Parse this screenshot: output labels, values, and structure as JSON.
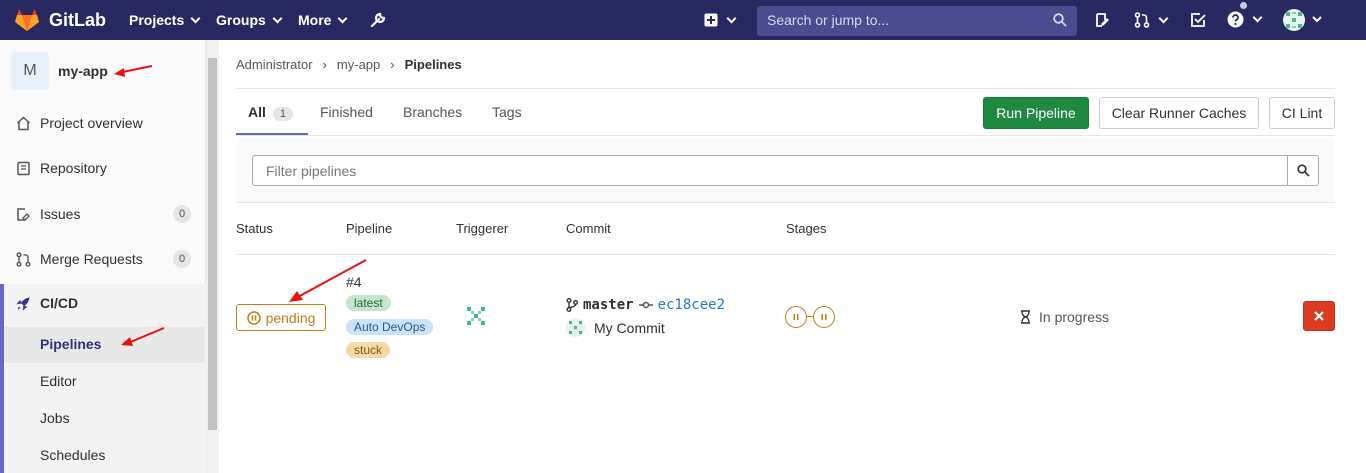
{
  "navbar": {
    "brand": "GitLab",
    "menus": [
      "Projects",
      "Groups",
      "More"
    ],
    "search_placeholder": "Search or jump to...",
    "bg_color": "#292961"
  },
  "sidebar": {
    "project_initial": "M",
    "project_name": "my-app",
    "items": [
      {
        "label": "Project overview",
        "icon": "home-icon"
      },
      {
        "label": "Repository",
        "icon": "book-icon"
      },
      {
        "label": "Issues",
        "icon": "issues-icon",
        "count": "0"
      },
      {
        "label": "Merge Requests",
        "icon": "merge-request-icon",
        "count": "0"
      },
      {
        "label": "CI/CD",
        "icon": "rocket-icon"
      }
    ],
    "cicd_sub": [
      "Pipelines",
      "Editor",
      "Jobs",
      "Schedules"
    ]
  },
  "breadcrumb": [
    "Administrator",
    "my-app",
    "Pipelines"
  ],
  "tabs": [
    {
      "label": "All",
      "count": "1"
    },
    {
      "label": "Finished"
    },
    {
      "label": "Branches"
    },
    {
      "label": "Tags"
    }
  ],
  "buttons": {
    "run": "Run Pipeline",
    "clear": "Clear Runner Caches",
    "lint": "CI Lint"
  },
  "filter": {
    "placeholder": "Filter pipelines"
  },
  "table": {
    "headers": [
      "Status",
      "Pipeline",
      "Triggerer",
      "Commit",
      "Stages"
    ],
    "row": {
      "status": "pending",
      "pipeline_id": "#4",
      "labels": [
        "latest",
        "Auto DevOps",
        "stuck"
      ],
      "branch": "master",
      "sha": "ec18cee2",
      "commit_message": "My Commit",
      "duration": "In progress"
    }
  },
  "colors": {
    "pending": "#c17d10",
    "run_button": "#1f8a3f",
    "cancel_button": "#db3b21",
    "annotation_arrow": "#e81010"
  }
}
